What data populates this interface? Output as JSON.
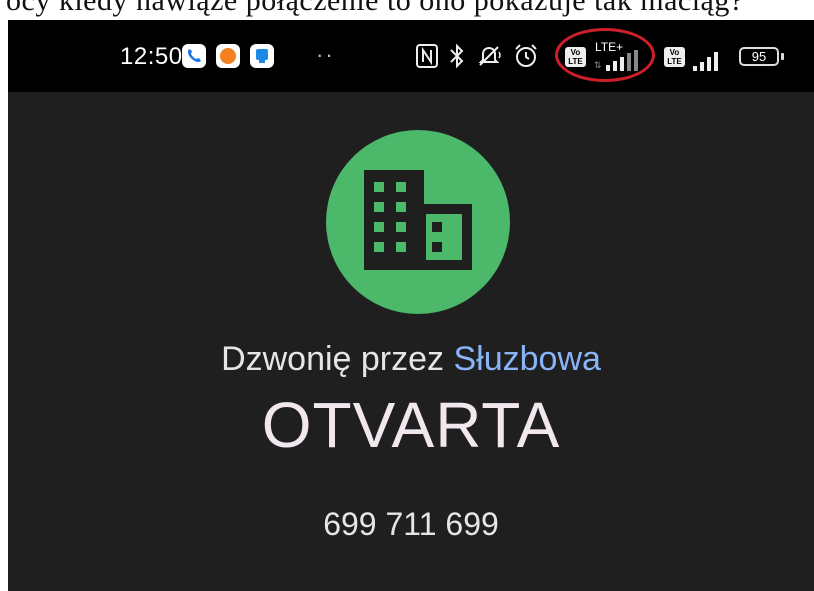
{
  "top_caption": "ócy kiedy nawiąże połączenie to ono pokazuje tak maciąg?",
  "status_bar": {
    "time": "12:50",
    "dots": "··",
    "lte_label": "LTE+",
    "volte_label": "Vo LTE",
    "battery": "95",
    "icons": [
      "phone-app-icon",
      "orange-app-icon",
      "blue-app-icon",
      "nfc-icon",
      "bluetooth-icon",
      "mute-icon",
      "alarm-icon",
      "volte-icon",
      "lte-signal-icon",
      "volte-icon-2",
      "signal-icon",
      "battery-icon"
    ]
  },
  "call": {
    "via_prefix": "Dzwonię przez",
    "via_account": "Słuzbowa",
    "name": "OTVARTA",
    "number": "699 711 699"
  },
  "colors": {
    "avatar": "#4cb86a",
    "account_link": "#8ab4f8",
    "annotation": "#cc1f2a",
    "background": "#1f1f1f"
  }
}
